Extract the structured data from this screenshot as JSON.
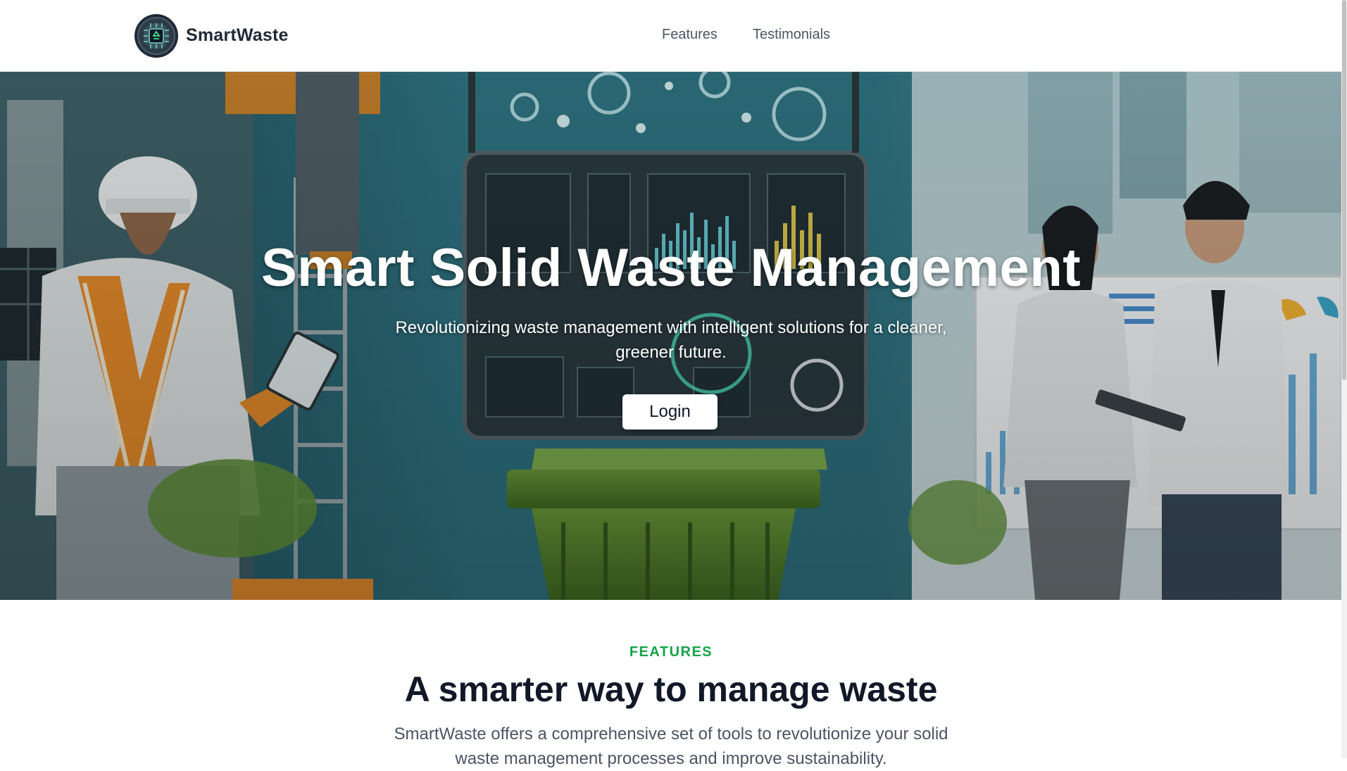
{
  "header": {
    "brand": "SmartWaste",
    "logo_icon": "recycle-chip-icon",
    "nav": [
      {
        "label": "Features"
      },
      {
        "label": "Testimonials"
      }
    ]
  },
  "hero": {
    "title": "Smart Solid Waste Management",
    "subtitle": "Revolutionizing waste management with intelligent solutions for a cleaner, greener future.",
    "login_label": "Login"
  },
  "features": {
    "eyebrow": "FEATURES",
    "title": "A smarter way to manage waste",
    "description": "SmartWaste offers a comprehensive set of tools to revolutionize your solid waste management processes and improve sustainability."
  },
  "colors": {
    "accent": "#16a34a",
    "hero_teal": "#2f6c77",
    "bin_green": "#5a8a2e"
  }
}
